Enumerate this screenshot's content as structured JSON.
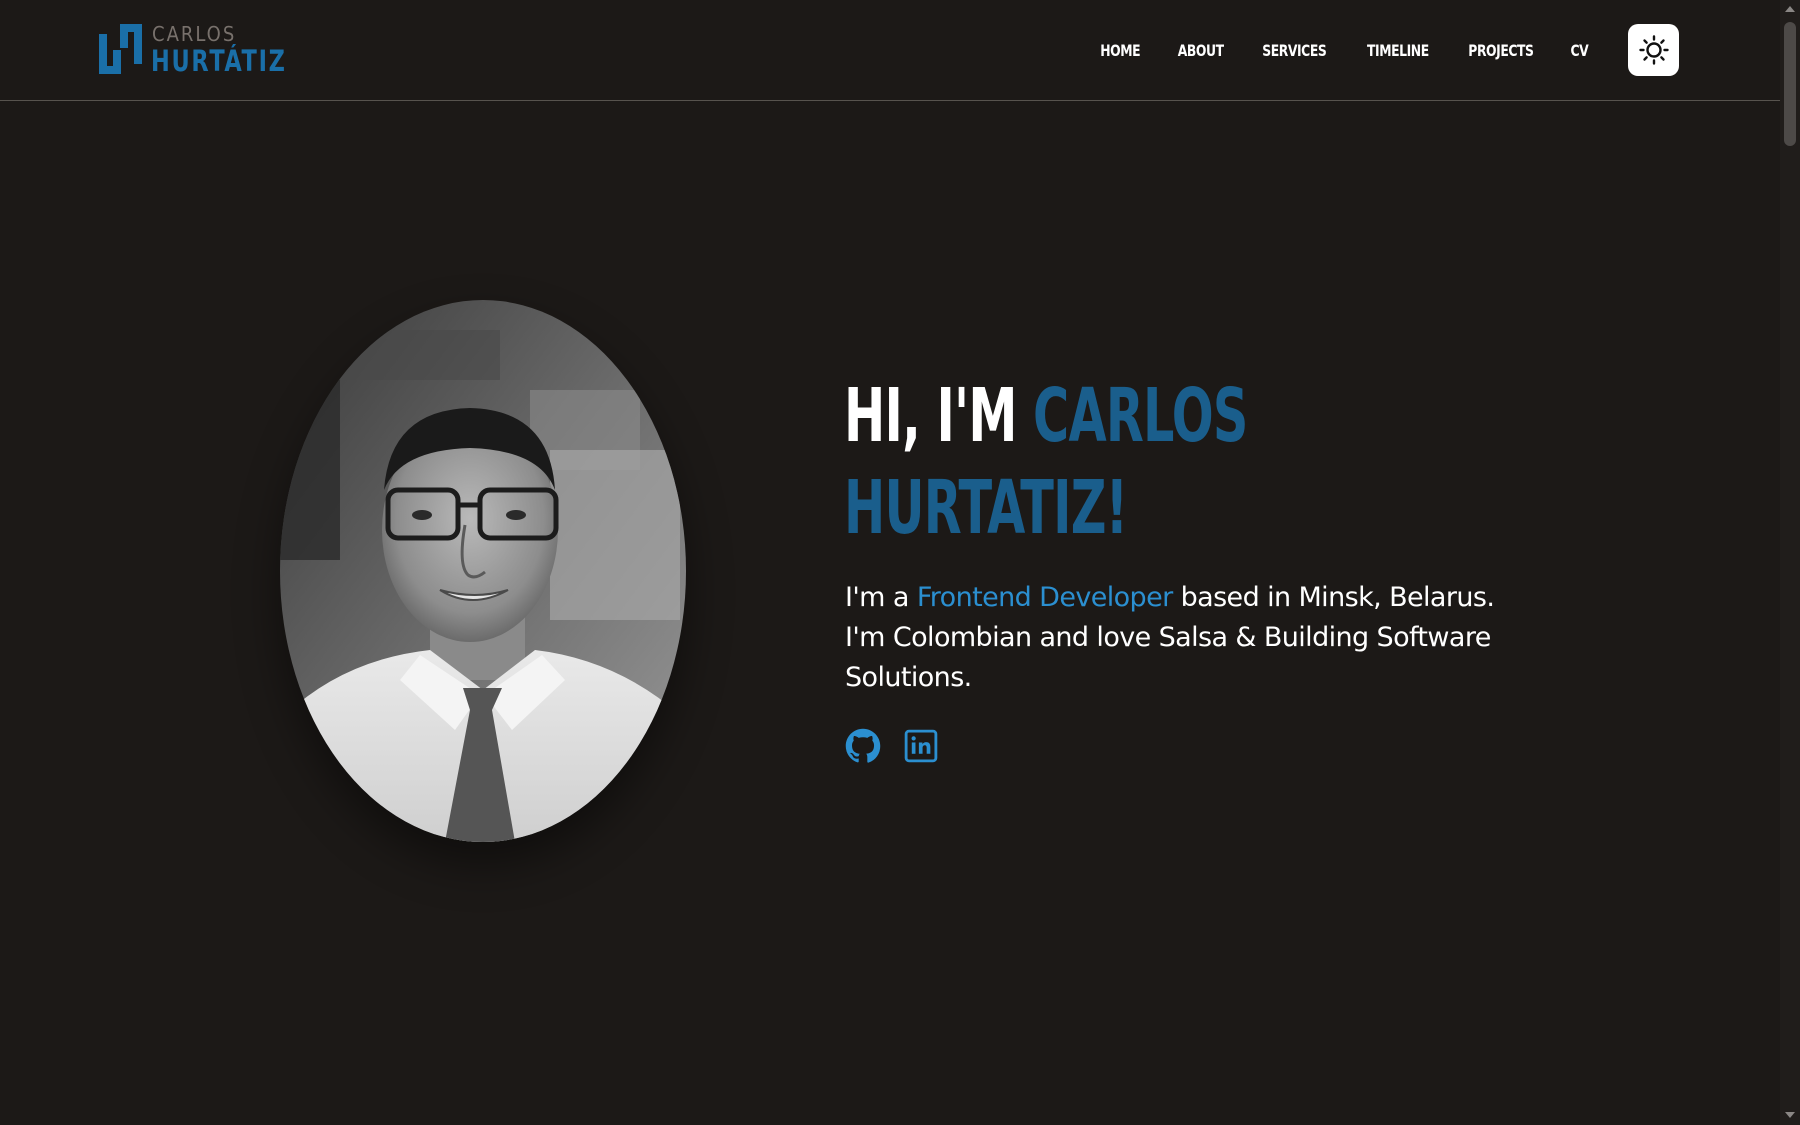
{
  "header": {
    "logo": {
      "first_name": "CARLOS",
      "last_name": "HURTÁTIZ"
    },
    "nav": [
      {
        "label": "HOME"
      },
      {
        "label": "ABOUT"
      },
      {
        "label": "SERVICES"
      },
      {
        "label": "TIMELINE"
      },
      {
        "label": "PROJECTS"
      },
      {
        "label": "CV"
      }
    ],
    "theme_toggle_icon": "sun-icon"
  },
  "hero": {
    "headline_part1": "HI, I'M ",
    "headline_part2": "CARLOS",
    "headline_part3": "HURTATIZ!",
    "bio_prefix": "I'm a ",
    "bio_role": "Frontend Developer",
    "bio_suffix": " based in Minsk, Belarus. I'm Colombian and love Salsa & Building Software Solutions.",
    "socials": [
      {
        "icon": "github-icon"
      },
      {
        "icon": "linkedin-icon"
      }
    ]
  },
  "colors": {
    "background": "#1c1917",
    "accent_dark": "#1a5e8c",
    "accent": "#2b8fd0",
    "toggle_bg": "#ffffff"
  }
}
